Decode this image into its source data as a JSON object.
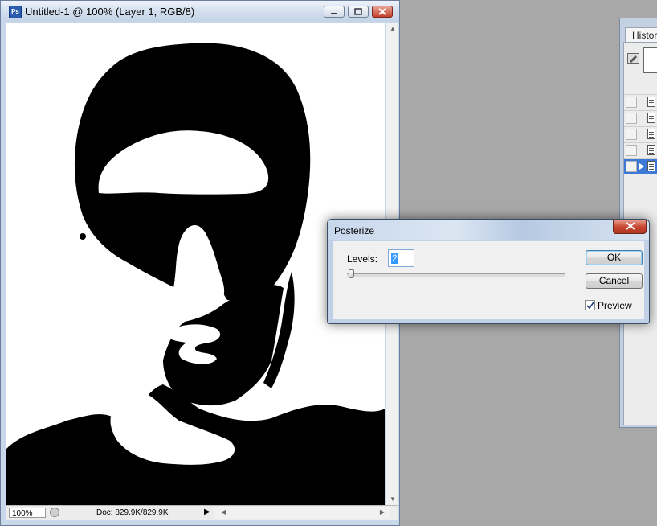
{
  "document": {
    "app_icon_text": "Ps",
    "title": "Untitled-1 @ 100% (Layer 1, RGB/8)",
    "zoom": "100%",
    "doc_size": "Doc: 829.9K/829.9K",
    "buttons": [
      "minimize",
      "maximize",
      "close"
    ]
  },
  "history_panel": {
    "tab_label": "History",
    "row_count": 5,
    "active_row": 5
  },
  "posterize_dialog": {
    "title": "Posterize",
    "levels_label": "Levels:",
    "levels_value": "2",
    "ok_label": "OK",
    "cancel_label": "Cancel",
    "preview_label": "Preview",
    "preview_checked": true
  },
  "colors": {
    "workspace_bg": "#a8a8a8",
    "selection": "#3399ff",
    "close_button": "#c8452f"
  }
}
